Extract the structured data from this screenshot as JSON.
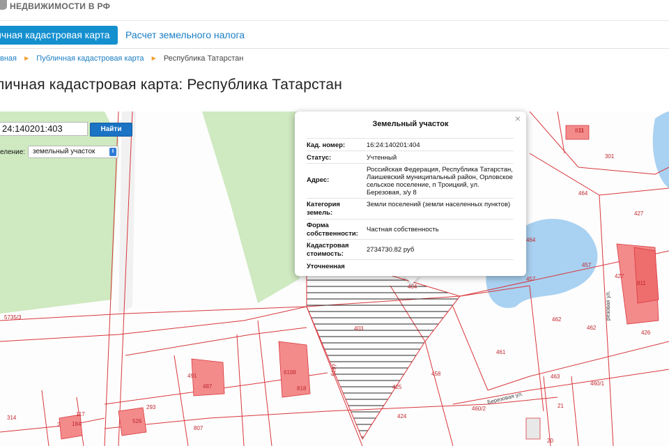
{
  "header": {
    "site_title": "НЕДВИЖИМОСТИ В РФ"
  },
  "tabs": [
    {
      "label": "ичная кадастровая карта",
      "active": true
    },
    {
      "label": "Расчет земельного налога",
      "active": false
    }
  ],
  "breadcrumb": {
    "items": [
      "вная",
      "Публичная кадастровая карта",
      "Республика Татарстан"
    ],
    "separator": "▶"
  },
  "page_title": "личная кадастровая карта: Республика Татарстан",
  "search": {
    "value": "24:140201:403",
    "button_label": "Найти"
  },
  "division": {
    "label": "еление:",
    "selected": "земельный участок"
  },
  "popup": {
    "close_label": "×",
    "title": "Земельный участок",
    "rows": [
      {
        "key": "Кад. номер:",
        "value": "16:24:140201:404"
      },
      {
        "key": "Статус:",
        "value": "Учтенный"
      },
      {
        "key": "Адрес:",
        "value": "Российская Федерация, Республика Татарстан, Лаишевский муниципальный район, Орловское сельское поселение, п Троицкий, ул. Березовая, з/у 8"
      },
      {
        "key": "Категория земель:",
        "value": "Земли поселений (земли населенных пунктов)"
      },
      {
        "key": "Форма собственности:",
        "value": "Частная собственность"
      },
      {
        "key": "Кадастровая стоимость:",
        "value": "2734730.82 руб"
      },
      {
        "key": "Уточненная",
        "value": ""
      }
    ]
  },
  "map": {
    "parcel_labels": [
      "404",
      "403",
      "425",
      "424",
      "458",
      "461",
      "462",
      "462",
      "463",
      "460/1",
      "460/2",
      "457",
      "457",
      "464",
      "464",
      "427",
      "427",
      "426",
      "301",
      "811",
      "811",
      "6198",
      "818",
      "491",
      "487",
      "293",
      "526",
      "117",
      "184",
      "314",
      "807",
      "5735/3",
      "6197",
      "21",
      "20",
      "11",
      "2"
    ],
    "street_labels": [
      "Березовая ул.",
      "резовая ул."
    ],
    "colors": {
      "green": "#cfe9c1",
      "water": "#a9d1f1",
      "building": "#f38b8b",
      "boundary": "#d9363c",
      "accent": "#1590cf"
    }
  }
}
